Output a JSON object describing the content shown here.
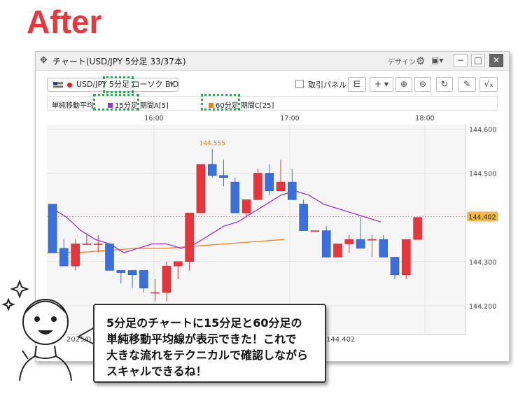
{
  "headline": "After",
  "window": {
    "title": "チャート(USD/JPY 5分足 33/37本)",
    "design_label": "デザイン",
    "buttons": [
      "−",
      "□",
      "✕"
    ]
  },
  "toolbar": {
    "symbol": "USD/JPY 5分足 ローソク BID",
    "trade_panel_label": "取引パネル"
  },
  "indicator_bar": {
    "label": "単純移動平均:",
    "items": [
      {
        "text": "15分足 期間A[5]",
        "color": "#9b30d9"
      },
      {
        "text": "60分足 期間C[25]",
        "color": "#f07f1e"
      }
    ]
  },
  "chart_data": {
    "type": "candlestick",
    "x_tick_labels": [
      "16:00",
      "17:00",
      "18:00"
    ],
    "y_tick_labels": [
      "144.600",
      "144.500",
      "144.402",
      "144.300",
      "144.200"
    ],
    "current_price": "144.402",
    "annotations": [
      "144.555",
      "144.402"
    ],
    "date_label": "2025/0",
    "colors": {
      "up": "#e5363e",
      "down": "#3a6fde",
      "sma_purple": "#9b30d9",
      "sma_orange": "#f07f1e",
      "price_line": "#f0a030"
    },
    "candles": [
      {
        "o": 144.43,
        "h": 144.43,
        "l": 144.32,
        "c": 144.32
      },
      {
        "o": 144.33,
        "h": 144.35,
        "l": 144.29,
        "c": 144.29
      },
      {
        "o": 144.29,
        "h": 144.35,
        "l": 144.28,
        "c": 144.34
      },
      {
        "o": 144.34,
        "h": 144.36,
        "l": 144.34,
        "c": 144.34
      },
      {
        "o": 144.34,
        "h": 144.36,
        "l": 144.32,
        "c": 144.34
      },
      {
        "o": 144.34,
        "h": 144.34,
        "l": 144.28,
        "c": 144.28
      },
      {
        "o": 144.28,
        "h": 144.28,
        "l": 144.25,
        "c": 144.275
      },
      {
        "o": 144.28,
        "h": 144.28,
        "l": 144.24,
        "c": 144.27
      },
      {
        "o": 144.28,
        "h": 144.28,
        "l": 144.23,
        "c": 144.24
      },
      {
        "o": 144.23,
        "h": 144.26,
        "l": 144.21,
        "c": 144.23
      },
      {
        "o": 144.23,
        "h": 144.3,
        "l": 144.21,
        "c": 144.29
      },
      {
        "o": 144.29,
        "h": 144.3,
        "l": 144.26,
        "c": 144.3
      },
      {
        "o": 144.3,
        "h": 144.41,
        "l": 144.28,
        "c": 144.41
      },
      {
        "o": 144.41,
        "h": 144.52,
        "l": 144.41,
        "c": 144.52
      },
      {
        "o": 144.52,
        "h": 144.555,
        "l": 144.49,
        "c": 144.495
      },
      {
        "o": 144.495,
        "h": 144.53,
        "l": 144.47,
        "c": 144.49
      },
      {
        "o": 144.48,
        "h": 144.49,
        "l": 144.41,
        "c": 144.41
      },
      {
        "o": 144.41,
        "h": 144.44,
        "l": 144.4,
        "c": 144.44
      },
      {
        "o": 144.44,
        "h": 144.51,
        "l": 144.44,
        "c": 144.5
      },
      {
        "o": 144.5,
        "h": 144.52,
        "l": 144.45,
        "c": 144.46
      },
      {
        "o": 144.46,
        "h": 144.53,
        "l": 144.46,
        "c": 144.48
      },
      {
        "o": 144.48,
        "h": 144.51,
        "l": 144.44,
        "c": 144.44
      },
      {
        "o": 144.43,
        "h": 144.44,
        "l": 144.37,
        "c": 144.37
      },
      {
        "o": 144.37,
        "h": 144.37,
        "l": 144.37,
        "c": 144.37
      },
      {
        "o": 144.37,
        "h": 144.38,
        "l": 144.31,
        "c": 144.31
      },
      {
        "o": 144.31,
        "h": 144.34,
        "l": 144.31,
        "c": 144.34
      },
      {
        "o": 144.34,
        "h": 144.36,
        "l": 144.32,
        "c": 144.35
      },
      {
        "o": 144.35,
        "h": 144.4,
        "l": 144.34,
        "c": 144.33
      },
      {
        "o": 144.35,
        "h": 144.36,
        "l": 144.31,
        "c": 144.35
      },
      {
        "o": 144.35,
        "h": 144.36,
        "l": 144.31,
        "c": 144.31
      },
      {
        "o": 144.31,
        "h": 144.31,
        "l": 144.26,
        "c": 144.27
      },
      {
        "o": 144.27,
        "h": 144.35,
        "l": 144.26,
        "c": 144.35
      },
      {
        "o": 144.35,
        "h": 144.4,
        "l": 144.35,
        "c": 144.4
      }
    ],
    "sma_purple": [
      144.42,
      144.4,
      144.37,
      144.35,
      144.34,
      144.32,
      144.33,
      144.34,
      144.34,
      144.33,
      144.34,
      144.36,
      144.38,
      144.39,
      144.41,
      144.43,
      144.45,
      144.46,
      144.45,
      144.43,
      144.42,
      144.41,
      144.4,
      144.39
    ],
    "sma_orange": [
      144.32,
      144.32,
      144.325,
      144.33,
      144.33,
      144.335,
      144.34,
      144.345,
      144.35
    ]
  },
  "bubble": {
    "text": "5分足のチャートに15分足と60分足の\n単純移動平均線が表示できた！これで\n大きな流れをテクニカルで確認しながら\nスキャルできるね！"
  }
}
